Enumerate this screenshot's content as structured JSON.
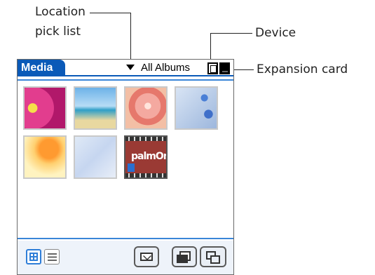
{
  "callouts": {
    "location_pick_list": "Location\npick list",
    "location_line1": "Location",
    "location_line2": "pick list",
    "device": "Device",
    "expansion_card": "Expansion card"
  },
  "app": {
    "title": "Media",
    "location_selected": "All Albums",
    "accent_color": "#0a5ab8"
  },
  "thumbnails": [
    {
      "name": "pink-flower-photo"
    },
    {
      "name": "palm-beach-photo"
    },
    {
      "name": "rose-photo"
    },
    {
      "name": "blue-bubbles-photo"
    },
    {
      "name": "orange-flower-photo"
    },
    {
      "name": "abstract-blue-photo"
    },
    {
      "name": "palmone-video",
      "label": "palmOne"
    }
  ],
  "toolbar": {
    "icons": [
      "grid-view-icon",
      "list-view-icon",
      "mail-icon",
      "copy-to-card-icon",
      "slideshow-icon"
    ]
  }
}
